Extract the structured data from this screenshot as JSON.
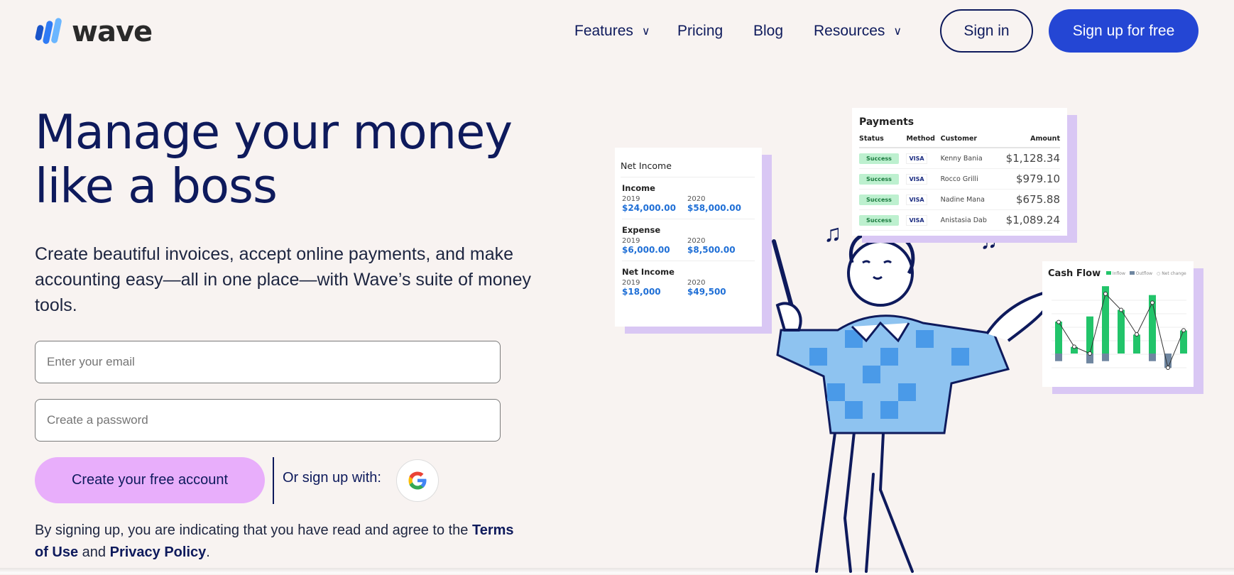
{
  "brand": {
    "name": "wave"
  },
  "nav": {
    "items": [
      {
        "label": "Features",
        "dropdown": true
      },
      {
        "label": "Pricing"
      },
      {
        "label": "Blog"
      },
      {
        "label": "Resources",
        "dropdown": true
      }
    ],
    "sign_in": "Sign in",
    "sign_up": "Sign up for free"
  },
  "hero": {
    "title": "Manage your money like a boss",
    "lead": "Create beautiful invoices, accept online payments, and make accounting easy—all in one place—with Wave’s suite of money tools."
  },
  "form": {
    "email_placeholder": "Enter your email",
    "password_placeholder": "Create a password",
    "create_label": "Create your free account",
    "or_label": "Or sign up with:",
    "google_icon": "google-icon",
    "terms_prefix": "By signing up, you are indicating that you have read and agree to the ",
    "terms_link": "Terms of Use",
    "terms_and": " and ",
    "privacy_link": "Privacy Policy",
    "terms_suffix": "."
  },
  "net_income_card": {
    "title": "Net Income",
    "sections": [
      {
        "label": "Income",
        "y1": "2019",
        "y2": "2020",
        "v1": "$24,000.00",
        "v2": "$58,000.00"
      },
      {
        "label": "Expense",
        "y1": "2019",
        "y2": "2020",
        "v1": "$6,000.00",
        "v2": "$8,500.00"
      },
      {
        "label": "Net Income",
        "y1": "2019",
        "y2": "2020",
        "v1": "$18,000",
        "v2": "$49,500"
      }
    ]
  },
  "payments_card": {
    "title": "Payments",
    "headers": [
      "Status",
      "Method",
      "Customer",
      "Amount"
    ],
    "rows": [
      {
        "status": "Success",
        "method": "VISA",
        "customer": "Kenny Bania",
        "amount": "$1,128.34"
      },
      {
        "status": "Success",
        "method": "VISA",
        "customer": "Rocco Grilli",
        "amount": "$979.10"
      },
      {
        "status": "Success",
        "method": "VISA",
        "customer": "Nadine Mana",
        "amount": "$675.88"
      },
      {
        "status": "Success",
        "method": "VISA",
        "customer": "Anistasia Dab",
        "amount": "$1,089.24"
      }
    ]
  },
  "cash_flow_card": {
    "title": "Cash Flow",
    "legend": [
      "Inflow",
      "Outflow",
      "Net change"
    ],
    "inflow": [
      15.5,
      3.2,
      18,
      32.7,
      21.2,
      9.2,
      28.4,
      0,
      11.2
    ],
    "outflow": [
      3.7,
      0,
      4.8,
      3.7,
      0,
      0,
      3.7,
      7,
      0
    ],
    "net": [
      15.3,
      3.3,
      0,
      29,
      21.2,
      9.3,
      24.7,
      -6.9,
      11.3
    ],
    "colors": {
      "inflow": "#22c46a",
      "outflow": "#6f86a0"
    }
  },
  "colors": {
    "primary": "#2446d4",
    "navy": "#0e1a5c",
    "cta": "#e8aefb",
    "bg": "#f8f3f1"
  }
}
